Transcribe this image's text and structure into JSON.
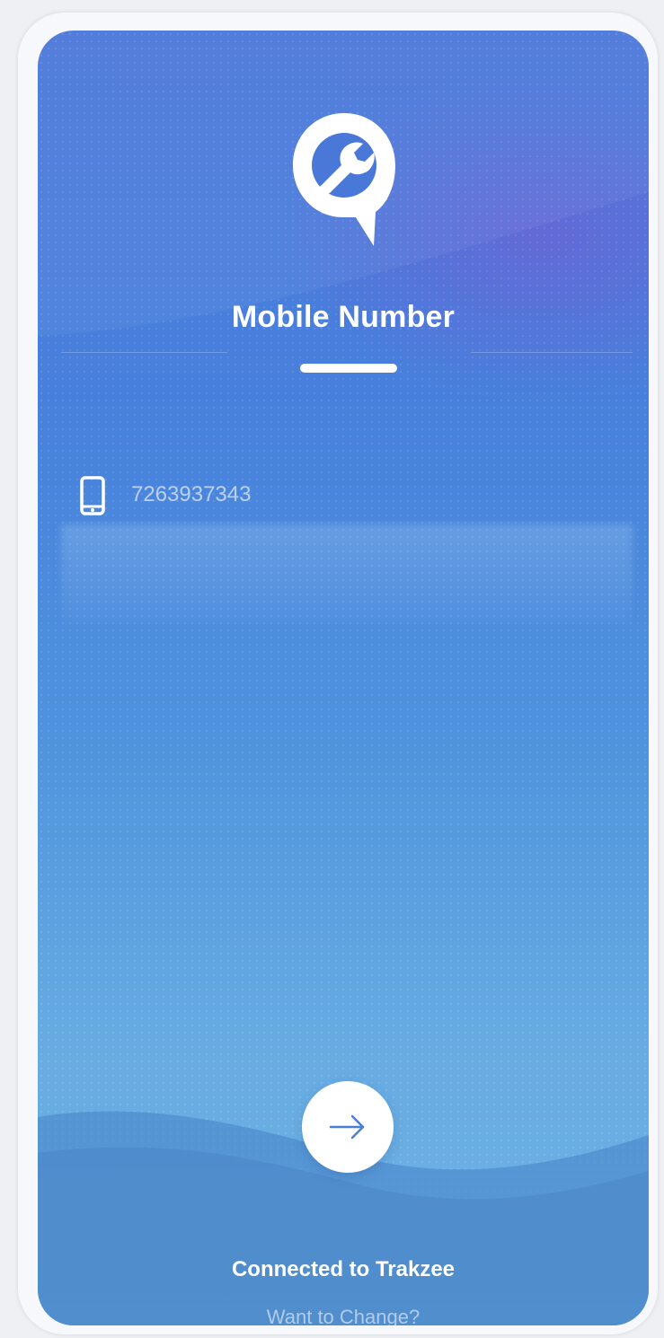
{
  "screen": {
    "title": "Mobile Number",
    "phone": {
      "value": "7263937343",
      "icon": "mobile-phone-icon"
    },
    "next_button": {
      "icon": "arrow-right-icon"
    },
    "status": "Connected to Trakzee",
    "change_link": "Want to Change?"
  },
  "colors": {
    "accent_blue": "#4a77da",
    "light_blue": "#6db3e4",
    "violet": "#785ad2",
    "white": "#ffffff"
  },
  "logo": {
    "icon": "wrench-location-icon"
  }
}
